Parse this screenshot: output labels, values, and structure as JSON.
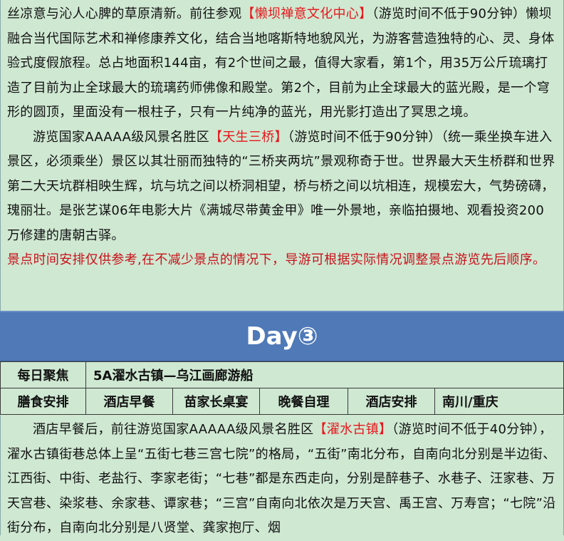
{
  "day2": {
    "para1": {
      "before": "丝凉意与沁人心脾的草原清新。前往参观",
      "highlight": "【懒坝禅意文化中心】",
      "after": "（游览时间不低于90分钟）懒坝融合当代国际艺术和禅修康养文化，结合当地喀斯特地貌风光，为游客营造独特的心、灵、身体验式度假旅程。总占地面积144亩，有2个世间之最，值得大家看，第1个，用35万公斤琉璃打造了目前为止全球最大的琉璃药师佛像和殿堂。第2个，目前为止全球最大的蓝光殿，是一个穹形的圆顶，里面没有一根柱子，只有一片纯净的蓝光，用光影打造出了冥思之境。"
    },
    "para2": {
      "before": "游览国家AAAAA级风景名胜区",
      "highlight": "【天生三桥】",
      "after": "（游览时间不低于90分钟）（统一乘坐换车进入景区，必须乘坐）景区以其壮丽而独特的“三桥夹两坑”景观称奇于世。世界最大天生桥群和世界第二大天坑群相映生辉，坑与坑之间以桥洞相望，桥与桥之间以坑相连，规模宏大，气势磅礴，瑰丽壮。是张艺谋06年电影大片《满城尽带黄金甲》唯一外景地，亲临拍摄地、观看投资200万修建的唐朝古驿。"
    },
    "notice": "景点时间安排仅供参考,在不减少景点的情况下，导游可根据实际情况调整景点游览先后顺序。"
  },
  "day3": {
    "title": "Day③",
    "focus_label": "每日聚焦",
    "focus_value": "5A濯水古镇—乌江画廊游船",
    "meals_label": "膳食安排",
    "breakfast": "酒店早餐",
    "lunch": "苗家长桌宴",
    "dinner": "晚餐自理",
    "hotel_label": "酒店安排",
    "hotel_value": "南川/重庆",
    "para1": {
      "before": "酒店早餐后，前往游览国家AAAAA级风景名胜区",
      "highlight": "【濯水古镇】",
      "after": "（游览时间不低于40分钟），濯水古镇街巷总体上呈“五街七巷三宫七院”的格局，“五街”南北分布，自南向北分别是半边街、江西街、中街、老盐行、李家老街；“七巷”都是东西走向，分别是醉巷子、水巷子、汪家巷、万天宫巷、染浆巷、余家巷、谭家巷；“三宫”自南向北依次是万天宫、禹王宫、万寿宫；“七院”沿街分布，自南向北分别是八贤堂、龚家抱厅、烟"
    }
  }
}
